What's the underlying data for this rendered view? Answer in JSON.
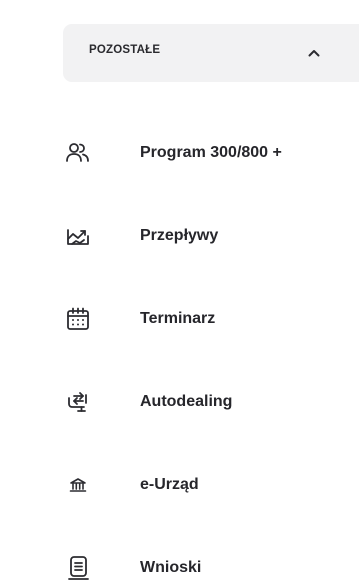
{
  "section": {
    "title": "POZOSTAŁE",
    "expanded": true,
    "toggle_icon": "chevron-up-icon"
  },
  "menu": {
    "items": [
      {
        "label": "Program 300/800 +",
        "icon": "users-icon"
      },
      {
        "label": "Przepływy",
        "icon": "flows-icon"
      },
      {
        "label": "Terminarz",
        "icon": "calendar-icon"
      },
      {
        "label": "Autodealing",
        "icon": "exchange-icon"
      },
      {
        "label": "e-Urząd",
        "icon": "government-building-icon"
      },
      {
        "label": "Wnioski",
        "icon": "document-icon"
      }
    ]
  },
  "colors": {
    "header_bg": "#f2f2f3",
    "text": "#26262b",
    "icon": "#2c2c31"
  }
}
